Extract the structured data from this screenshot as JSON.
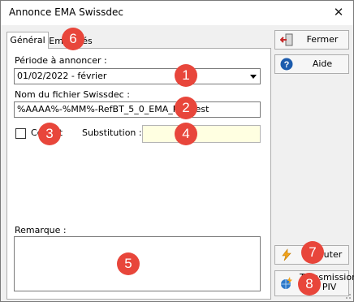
{
  "window": {
    "title": "Annonce EMA Swissdec"
  },
  "tabs": [
    {
      "label": "Général"
    },
    {
      "label": "Employés"
    }
  ],
  "form": {
    "period_label": "Période à annoncer :",
    "period_value": "01/02/2022 - février",
    "filename_label": "Nom du fichier Swissdec :",
    "filename_value": "%AAAA%-%MM%-RefBT_5_0_EMA_Request",
    "test_label": "Ce test",
    "substitution_label": "Substitution :",
    "substitution_value": "",
    "remark_label": "Remarque :",
    "remark_value": ""
  },
  "buttons": {
    "close": "Fermer",
    "help": "Aide",
    "execute": "Exécuter",
    "transmission": "Transmission au PIV"
  },
  "badges": [
    "1",
    "2",
    "3",
    "4",
    "5",
    "6",
    "7",
    "8"
  ],
  "colors": {
    "badge": "#e8463b",
    "substitution_bg": "#ffffe1",
    "help_icon": "#1b5bad"
  }
}
